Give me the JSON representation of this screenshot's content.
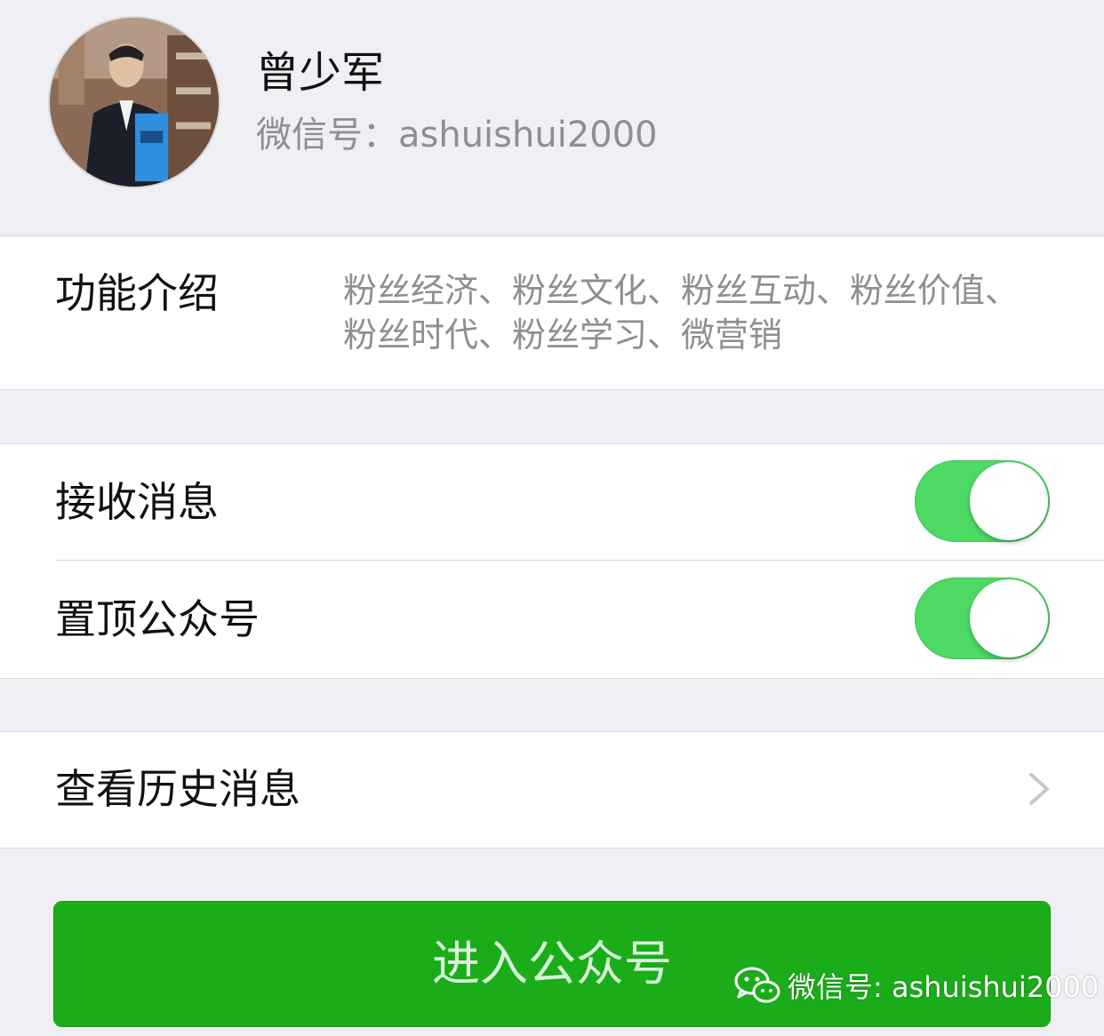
{
  "profile": {
    "name": "曾少军",
    "wechat_id": "微信号：ashuishui2000"
  },
  "intro": {
    "title": "功能介绍",
    "description": "粉丝经济、粉丝文化、粉丝互动、粉丝价值、粉丝时代、粉丝学习、微营销"
  },
  "settings": {
    "receive_messages": {
      "label": "接收消息",
      "on": true
    },
    "pin_account": {
      "label": "置顶公众号",
      "on": true
    }
  },
  "history": {
    "label": "查看历史消息"
  },
  "enter_button": {
    "label": "进入公众号"
  },
  "watermark": {
    "text": "微信号: ashuishui2000"
  },
  "colors": {
    "accent": "#1aad19",
    "switch_on": "#4cd964",
    "background": "#efeff4"
  },
  "icons": [
    "avatar",
    "chevron-right-icon",
    "wechat-logo-icon"
  ]
}
